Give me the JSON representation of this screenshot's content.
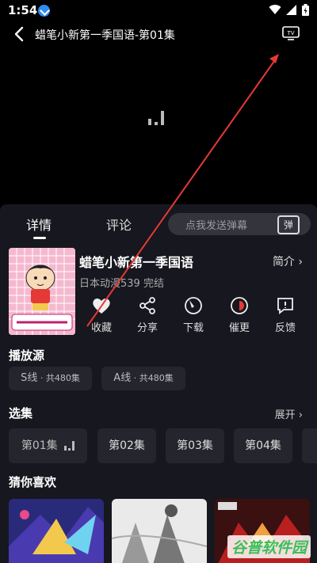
{
  "status_bar": {
    "time": "1:54"
  },
  "header": {
    "title": "蜡笔小新第一季国语-第01集"
  },
  "tabs": [
    {
      "label": "详情"
    },
    {
      "label": "评论"
    }
  ],
  "danmu": {
    "placeholder": "点我发送弹幕",
    "button": "弹"
  },
  "anime": {
    "title": "蜡笔小新第一季国语",
    "subtitle": "日本动漫539 完结",
    "intro_label": "简介 ›"
  },
  "actions": [
    {
      "label": "收藏",
      "icon": "heart-icon"
    },
    {
      "label": "分享",
      "icon": "share-icon"
    },
    {
      "label": "下载",
      "icon": "download-icon"
    },
    {
      "label": "催更",
      "icon": "urge-icon"
    },
    {
      "label": "反馈",
      "icon": "feedback-icon"
    }
  ],
  "sources": {
    "title": "播放源",
    "items": [
      {
        "label": "S线",
        "count": " · 共480集"
      },
      {
        "label": "A线",
        "count": " · 共480集"
      }
    ]
  },
  "episodes": {
    "title": "选集",
    "more": "展开 ›",
    "items": [
      "第01集",
      "第02集",
      "第03集",
      "第04集"
    ]
  },
  "recommend": {
    "title": "猜你喜欢"
  },
  "watermark": "谷普软件园",
  "colors": {
    "panel": "#17171f",
    "chip": "#25252d",
    "accent_arrow": "#e53935"
  }
}
